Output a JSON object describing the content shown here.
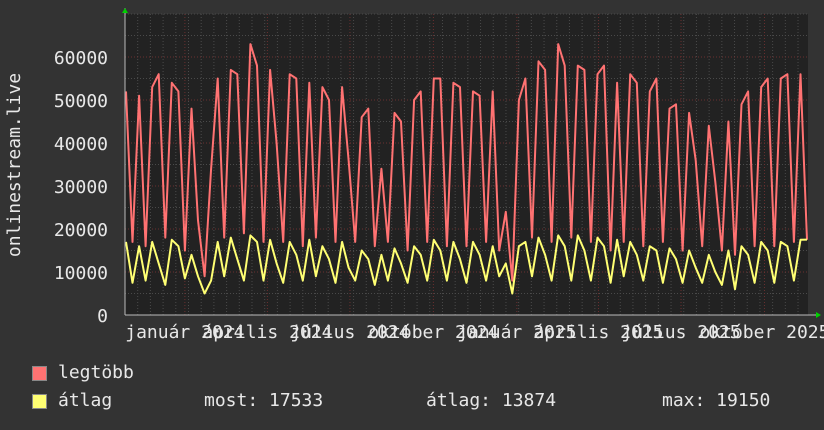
{
  "chart_data": {
    "type": "line",
    "ylabel": "onlinestream.live",
    "ylim": [
      0,
      70000
    ],
    "yticks": [
      0,
      10000,
      20000,
      30000,
      40000,
      50000,
      60000
    ],
    "xlim": [
      "2023-10-27",
      "2025-11-18"
    ],
    "xticks": [
      {
        "date": "2024-01-01",
        "label": "január 2024"
      },
      {
        "date": "2024-04-01",
        "label": "április 2024"
      },
      {
        "date": "2024-07-01",
        "label": "július 2024"
      },
      {
        "date": "2024-10-01",
        "label": "október 2024"
      },
      {
        "date": "2025-01-01",
        "label": "január 2025"
      },
      {
        "date": "2025-04-01",
        "label": "április 2025"
      },
      {
        "date": "2025-07-01",
        "label": "július 2025"
      },
      {
        "date": "2025-10-01",
        "label": "október 2025"
      }
    ],
    "grid": true,
    "legend_placement": "bottom-left",
    "series": [
      {
        "name": "legtöbb",
        "color": "#ff7272",
        "values": [
          52000,
          17000,
          51000,
          16000,
          53000,
          56000,
          18000,
          54000,
          52000,
          15000,
          48000,
          22000,
          9000,
          34000,
          55000,
          18000,
          57000,
          56000,
          19000,
          63000,
          58000,
          17000,
          57000,
          40000,
          17000,
          56000,
          55000,
          16000,
          54000,
          18000,
          53000,
          50000,
          17000,
          53000,
          36000,
          17000,
          46000,
          48000,
          16000,
          34000,
          17000,
          47000,
          45000,
          15000,
          50000,
          52000,
          17000,
          55000,
          55000,
          16000,
          54000,
          53000,
          16000,
          52000,
          51000,
          17000,
          52000,
          15000,
          24000,
          8000,
          50000,
          55000,
          18000,
          59000,
          57000,
          17000,
          63000,
          58000,
          18000,
          58000,
          57000,
          17000,
          56000,
          58000,
          15000,
          54000,
          17000,
          56000,
          54000,
          16000,
          52000,
          55000,
          17000,
          48000,
          49000,
          15000,
          47000,
          36000,
          16000,
          44000,
          31000,
          15000,
          45000,
          14000,
          49000,
          52000,
          16000,
          53000,
          55000,
          16000,
          55000,
          56000,
          17000,
          56000,
          17500
        ]
      },
      {
        "name": "átlag",
        "color": "#ffff73",
        "values": [
          17000,
          7500,
          16000,
          8000,
          17000,
          12000,
          7000,
          17500,
          16000,
          8500,
          14000,
          9000,
          5000,
          8000,
          17000,
          9000,
          18000,
          13000,
          8000,
          18500,
          17000,
          8000,
          17500,
          12000,
          7500,
          17000,
          14000,
          8000,
          17500,
          9000,
          16000,
          13000,
          7500,
          17000,
          11000,
          8000,
          15000,
          13000,
          7000,
          14000,
          8000,
          15500,
          12000,
          7500,
          16000,
          14000,
          8000,
          17500,
          15000,
          8000,
          17000,
          13000,
          7500,
          17000,
          14000,
          8000,
          16000,
          9000,
          12000,
          5000,
          16000,
          17000,
          9000,
          18000,
          14000,
          8000,
          18500,
          16000,
          8000,
          18500,
          15000,
          8000,
          18000,
          16000,
          7500,
          17500,
          9000,
          17000,
          14000,
          8000,
          16000,
          15000,
          7500,
          15500,
          13000,
          7500,
          15000,
          11000,
          7500,
          14000,
          10000,
          7000,
          15000,
          6000,
          16000,
          14000,
          7500,
          17000,
          15000,
          7500,
          17000,
          16000,
          8000,
          17500,
          17533
        ]
      }
    ]
  },
  "legend": {
    "items": [
      {
        "label": "legtöbb",
        "color": "#ff7272"
      },
      {
        "label": "átlag",
        "color": "#ffff73"
      }
    ],
    "stats": {
      "most": "most: 17533",
      "atlag": "átlag: 13874",
      "max": "max: 19150"
    }
  }
}
